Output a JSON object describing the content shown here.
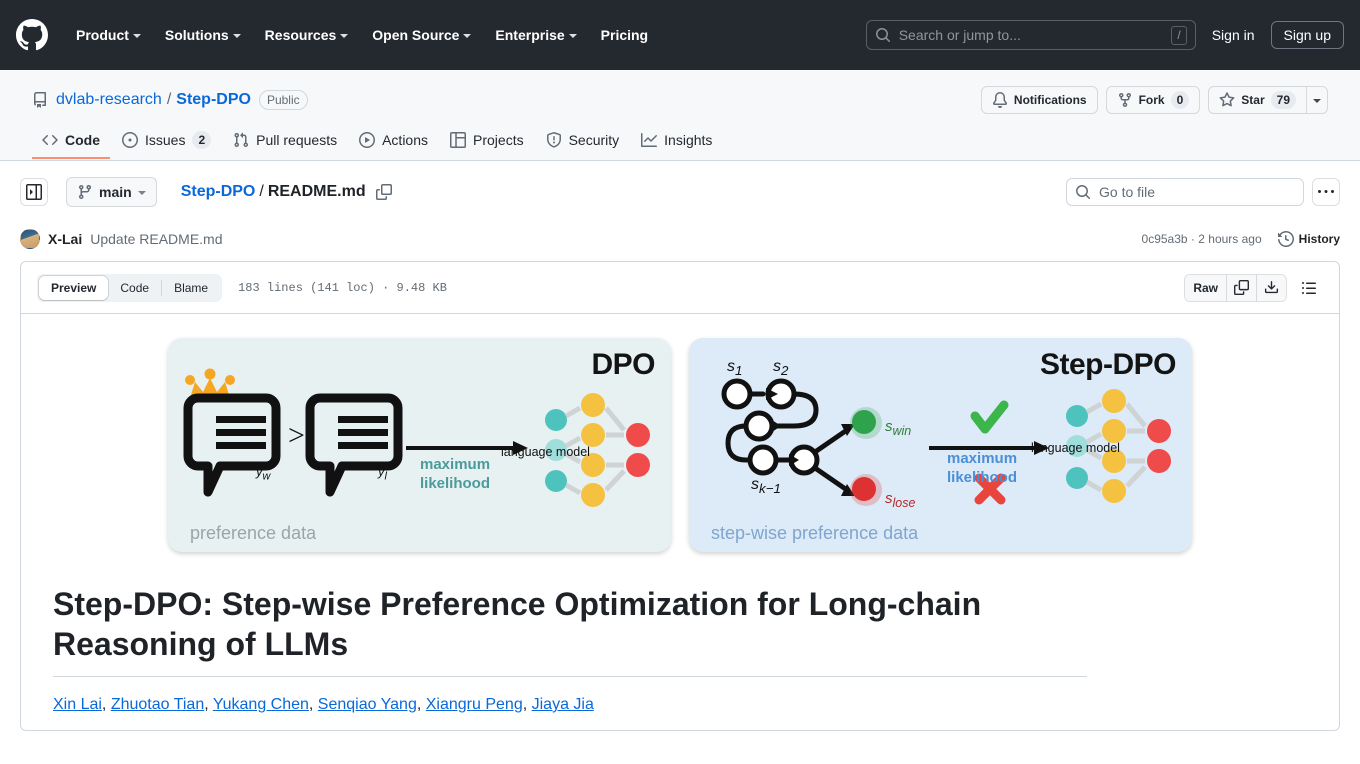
{
  "global_header": {
    "logo_icon": "github-mark-icon",
    "nav": [
      {
        "label": "Product",
        "has_dropdown": true
      },
      {
        "label": "Solutions",
        "has_dropdown": true
      },
      {
        "label": "Resources",
        "has_dropdown": true
      },
      {
        "label": "Open Source",
        "has_dropdown": true
      },
      {
        "label": "Enterprise",
        "has_dropdown": true
      },
      {
        "label": "Pricing",
        "has_dropdown": false
      }
    ],
    "search": {
      "icon": "search-icon",
      "placeholder": "Search or jump to...",
      "shortcut_key": "/"
    },
    "sign_in": "Sign in",
    "sign_up": "Sign up",
    "background_color": "#24292f"
  },
  "repo": {
    "icon": "repo-icon",
    "owner": "dvlab-research",
    "separator": "/",
    "name": "Step-DPO",
    "visibility": "Public",
    "actions": {
      "notifications": {
        "label": "Notifications",
        "icon": "bell-icon"
      },
      "fork": {
        "label": "Fork",
        "count": "0",
        "icon": "fork-icon"
      },
      "star": {
        "label": "Star",
        "count": "79",
        "icon": "star-icon",
        "dropdown_icon": "chevron-down-icon"
      }
    },
    "tabs": [
      {
        "label": "Code",
        "icon": "code-icon",
        "active": true,
        "count": ""
      },
      {
        "label": "Issues",
        "icon": "issue-opened-icon",
        "active": false,
        "count": "2"
      },
      {
        "label": "Pull requests",
        "icon": "git-pull-request-icon",
        "active": false,
        "count": ""
      },
      {
        "label": "Actions",
        "icon": "play-icon",
        "active": false,
        "count": ""
      },
      {
        "label": "Projects",
        "icon": "table-icon",
        "active": false,
        "count": ""
      },
      {
        "label": "Security",
        "icon": "shield-icon",
        "active": false,
        "count": ""
      },
      {
        "label": "Insights",
        "icon": "graph-icon",
        "active": false,
        "count": ""
      }
    ],
    "active_tab_underline_color": "#fd8c73"
  },
  "file_nav": {
    "sidebar_toggle_icon": "sidebar-expand-icon",
    "branch": {
      "label": "main",
      "icon": "git-branch-icon",
      "caret": "chevron-down-icon"
    },
    "breadcrumb": {
      "repo": "Step-DPO",
      "separator": "/",
      "file": "README.md",
      "copy_icon": "copy-path-icon"
    },
    "go_to_file": {
      "placeholder": "Go to file",
      "icon": "search-icon"
    },
    "more_menu": {
      "icon": "kebab-horizontal-icon",
      "label": "..."
    }
  },
  "commit": {
    "avatar": "user-avatar",
    "author": "X-Lai",
    "message": "Update README.md",
    "sha": "0c95a3b",
    "separator": "·",
    "time": "2 hours ago",
    "history": {
      "label": "History",
      "icon": "history-icon"
    }
  },
  "file_toolbar": {
    "views": [
      {
        "label": "Preview",
        "active": true
      },
      {
        "label": "Code",
        "active": false
      },
      {
        "label": "Blame",
        "active": false
      }
    ],
    "stats": "183 lines (141 loc) · 9.48 KB",
    "raw_label": "Raw",
    "copy_icon": "copy-icon",
    "download_icon": "download-icon",
    "outline_icon": "list-unordered-icon"
  },
  "readme": {
    "figure": {
      "left_panel": {
        "title": "DPO",
        "caption": "preference data",
        "arrow_label_line1": "maximum",
        "arrow_label_line2": "likelihood",
        "model_label": "language model",
        "bubble_labels": [
          "y_w",
          "y_l"
        ],
        "comparator": ">",
        "crown_icon": "crown-icon",
        "background_color": "#e8f1f2",
        "accent_color": "#4b9b9b"
      },
      "right_panel": {
        "title": "Step-DPO",
        "caption": "step-wise preference data",
        "arrow_label_line1": "maximum",
        "arrow_label_line2": "likelihood",
        "model_label": "language model",
        "node_labels": [
          "s₁",
          "s₂",
          "s_{k-1}"
        ],
        "win_label": "s_win",
        "lose_label": "s_lose",
        "check_icon": "check-mark-icon",
        "cross_icon": "cross-mark-icon",
        "background_color": "#ddeaf7",
        "accent_color": "#4b90d6"
      }
    },
    "title": "Step-DPO: Step-wise Preference Optimization for Long-chain Reasoning of LLMs",
    "authors": [
      "Xin Lai",
      "Zhuotao Tian",
      "Yukang Chen",
      "Senqiao Yang",
      "Xiangru Peng",
      "Jiaya Jia"
    ],
    "author_separator": ", "
  }
}
